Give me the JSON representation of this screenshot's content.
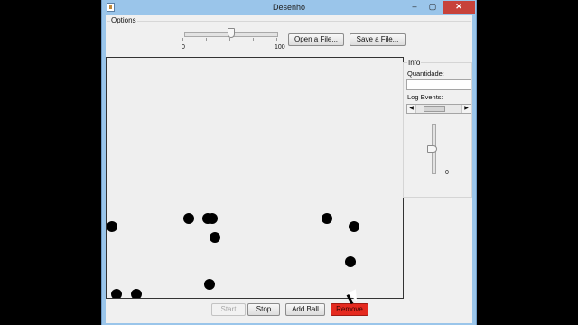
{
  "window": {
    "title": "Desenho",
    "controls": [
      "–",
      "▢",
      "✕"
    ]
  },
  "options": {
    "label": "Options",
    "slider": {
      "min_label": "0",
      "max_label": "100",
      "value": 50
    },
    "open_button": "Open a File...",
    "save_button": "Save a File..."
  },
  "info": {
    "title": "Info",
    "quantity_label": "Quantidade:",
    "quantity_value": "",
    "log_label": "Log Events:",
    "v_slider": {
      "value_label": "0"
    }
  },
  "buttons": {
    "start": "Start",
    "stop": "Stop",
    "add_ball": "Add Ball",
    "remove": "Remove"
  },
  "colors": {
    "titlebar": "#9ac5ea",
    "remove_button": "#e52a1f",
    "ball": "#000000"
  }
}
